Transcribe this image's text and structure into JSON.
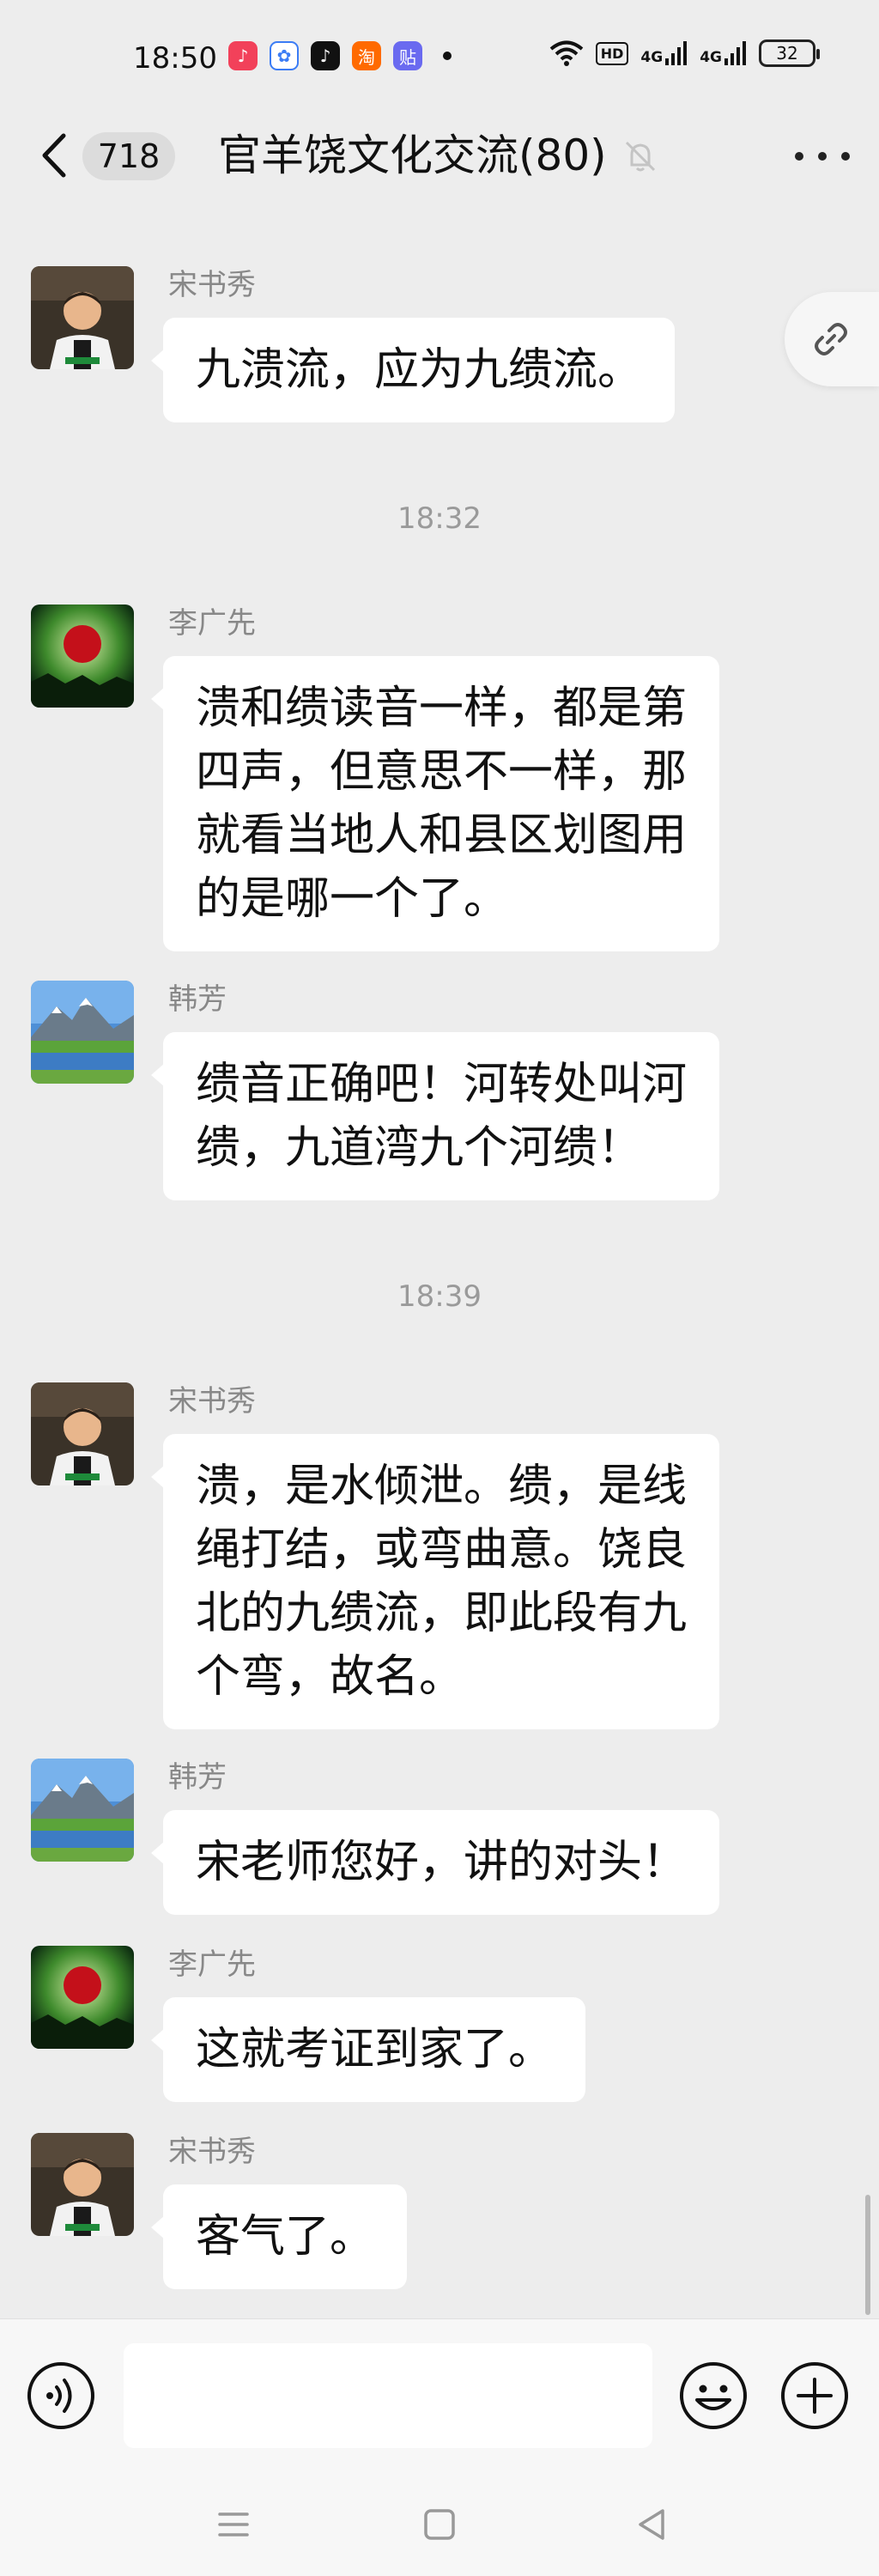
{
  "status_bar": {
    "time": "18:50",
    "hd_label": "HD",
    "net1_label": "4G",
    "net2_label": "4G",
    "battery": "32",
    "app_icons": [
      "music-app-icon",
      "baidu-app-icon",
      "tiktok-app-icon",
      "taobao-app-icon",
      "tieba-app-icon"
    ]
  },
  "header": {
    "unread_count": "718",
    "title": "官羊饶文化交流(80)"
  },
  "messages": [
    {
      "sender": "宋书秀",
      "lines": [
        "九溃流，应为九缋流。"
      ]
    },
    {
      "sender": "李广先",
      "lines": [
        "溃和缋读音一样，都是第",
        "四声，但意思不一样，那",
        "就看当地人和县区划图用",
        "的是哪一个了。"
      ]
    },
    {
      "sender": "韩芳",
      "lines": [
        "缋音正确吧！河转处叫河",
        "缋，九道湾九个河缋！"
      ]
    },
    {
      "sender": "宋书秀",
      "lines": [
        "溃，是水倾泄。缋，是线",
        "绳打结，或弯曲意。饶良",
        "北的九缋流，即此段有九",
        "个弯，故名。"
      ]
    },
    {
      "sender": "韩芳",
      "lines": [
        "宋老师您好，讲的对头！"
      ]
    },
    {
      "sender": "李广先",
      "lines": [
        "这就考证到家了。"
      ]
    },
    {
      "sender": "宋书秀",
      "lines": [
        "客气了。"
      ]
    }
  ],
  "timestamps": [
    "18:32",
    "18:39"
  ],
  "input": {
    "placeholder": ""
  },
  "colors": {
    "background": "#ededed",
    "bubble": "#ffffff",
    "sender": "#888888"
  }
}
